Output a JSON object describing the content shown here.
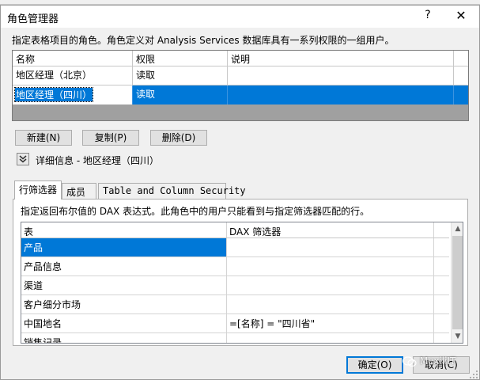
{
  "dialog": {
    "title": "角色管理器",
    "help": "?",
    "close": "✕",
    "description": "指定表格项目的角色。角色定义对 Analysis Services 数据库具有一系列权限的一组用户。"
  },
  "roles_table": {
    "headers": [
      "名称",
      "权限",
      "说明"
    ],
    "rows": [
      {
        "name": "地区经理（北京）",
        "permission": "读取",
        "description": ""
      },
      {
        "name": "地区经理（四川）",
        "permission": "读取",
        "description": ""
      }
    ]
  },
  "role_buttons": {
    "new": "新建(N)",
    "copy": "复制(P)",
    "delete": "删除(D)"
  },
  "details": {
    "label": "详细信息 - 地区经理（四川）"
  },
  "tabs": [
    "行筛选器",
    "成员",
    "Table and Column Security"
  ],
  "row_filters": {
    "description": "指定返回布尔值的 DAX 表达式。此角色中的用户只能看到与指定筛选器匹配的行。",
    "headers": [
      "表",
      "DAX 筛选器"
    ],
    "rows": [
      {
        "table": "产品",
        "filter": ""
      },
      {
        "table": "产品信息",
        "filter": ""
      },
      {
        "table": "渠道",
        "filter": ""
      },
      {
        "table": "客户细分市场",
        "filter": ""
      },
      {
        "table": "中国地名",
        "filter": "=[名称] = \"四川省\""
      },
      {
        "table": "销售记录",
        "filter": ""
      }
    ]
  },
  "footer": {
    "ok": "确定(O)",
    "cancel": "取消(C)"
  },
  "watermark": "MexiliIT",
  "colors": {
    "selection": "#0078d7",
    "dialog_bg": "#f0f0f0",
    "grid_bg": "#a0a0a0"
  }
}
